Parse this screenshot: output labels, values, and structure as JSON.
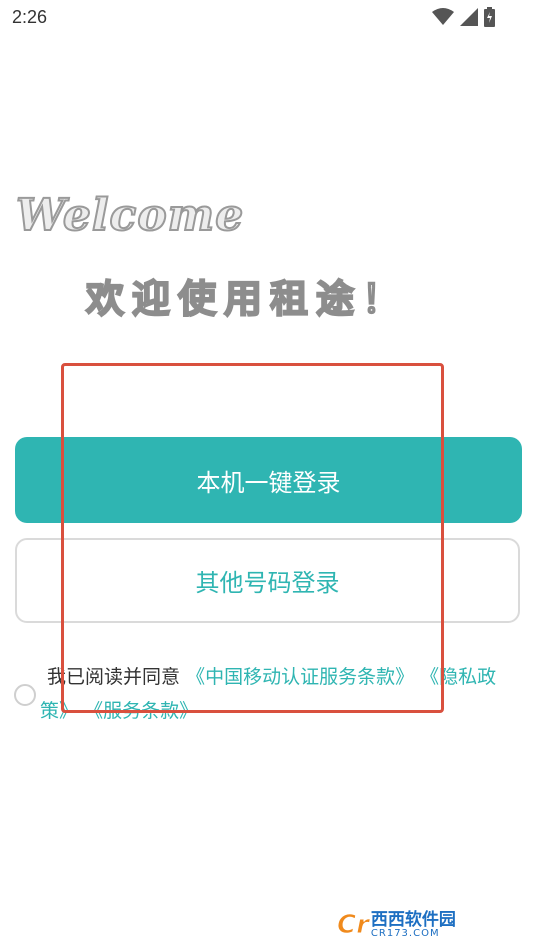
{
  "status_bar": {
    "time": "2:26",
    "icons": [
      "wifi-icon",
      "cell-signal-icon",
      "battery-icon"
    ]
  },
  "welcome": {
    "english": "Welcome",
    "chinese": "欢迎使用租途！"
  },
  "login": {
    "one_click_label": "本机一键登录",
    "other_number_label": "其他号码登录"
  },
  "agreement": {
    "prefix": "我已阅读并同意",
    "cmcc_terms": "《中国移动认证服务条款》",
    "privacy_policy": "《隐私政策》",
    "service_terms": "《服务条款》"
  },
  "watermark": {
    "badge": "Cr",
    "site_cn": "西西软件园",
    "site_en": "CR173.COM"
  },
  "colors": {
    "accent": "#2fb5b2",
    "annotation": "#d9503e"
  }
}
